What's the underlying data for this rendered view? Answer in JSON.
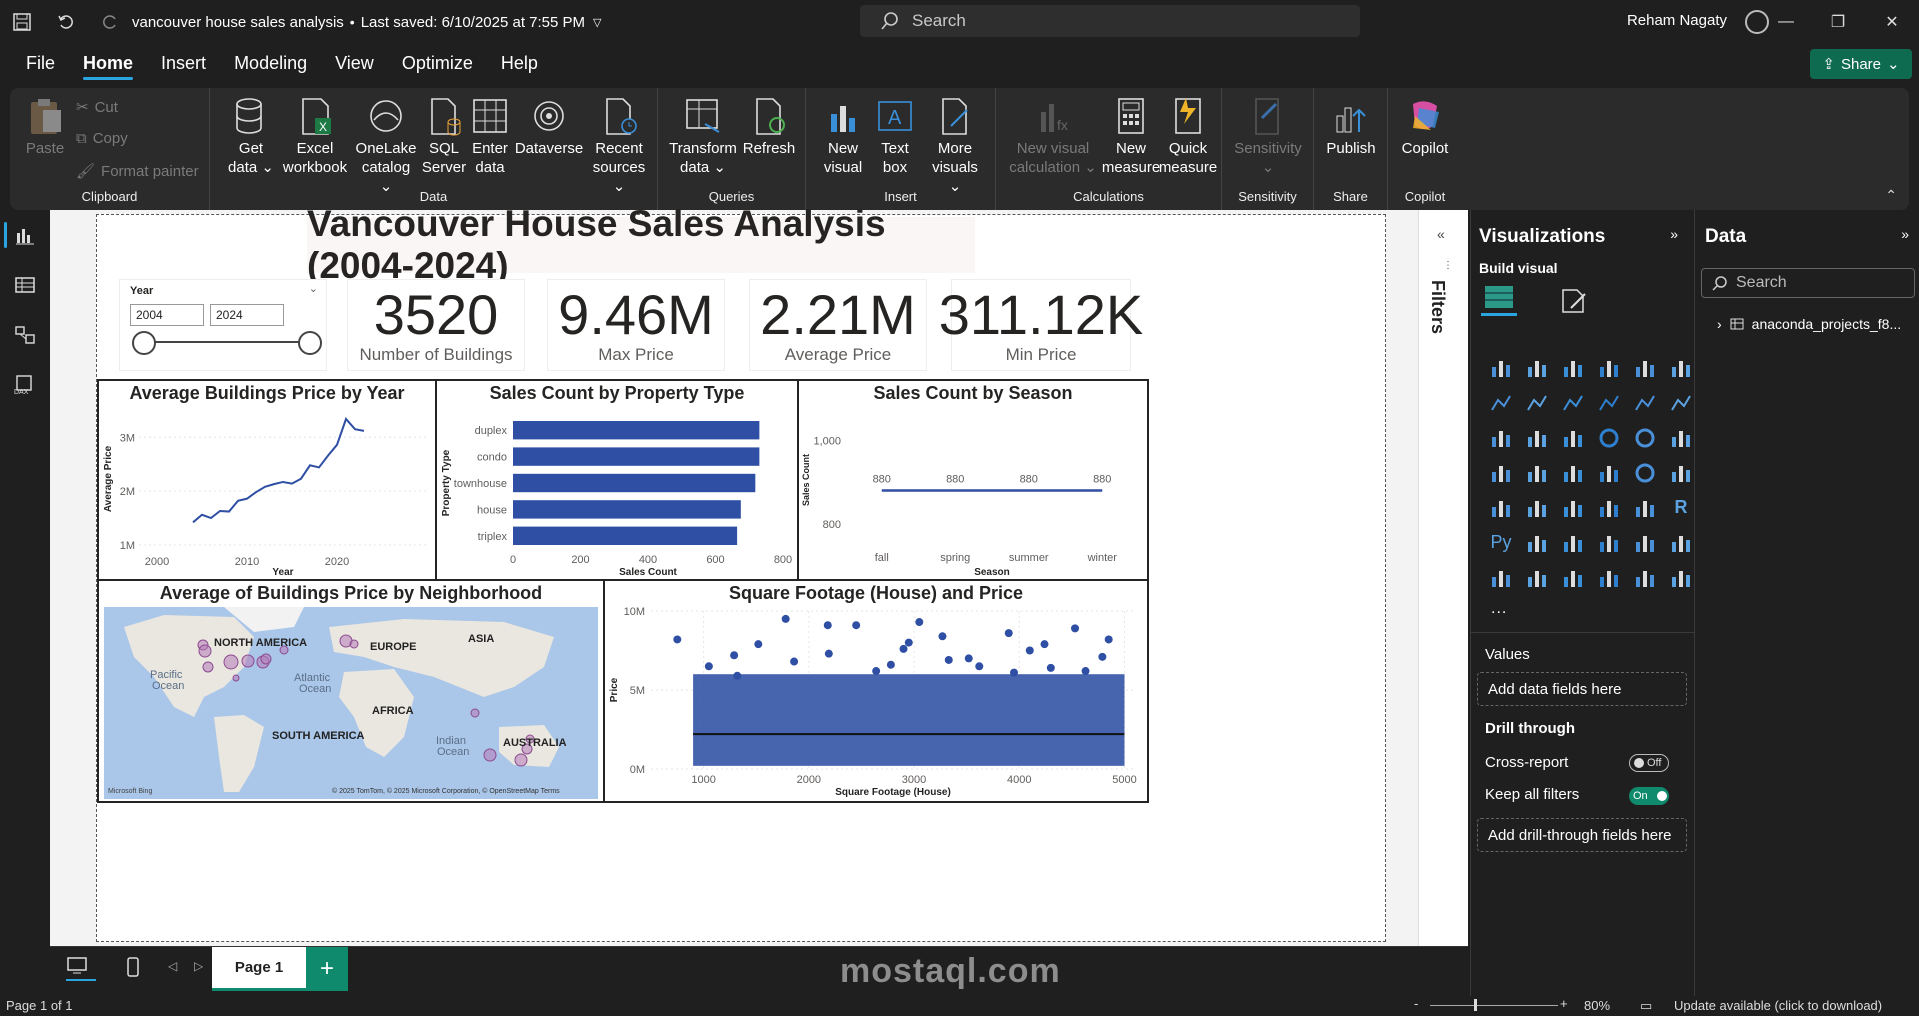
{
  "titlebar": {
    "title": "vancouver house sales analysis",
    "saved": "Last saved: 6/10/2025 at 7:55 PM",
    "search_placeholder": "Search",
    "user": "Reham Nagaty"
  },
  "menu": {
    "items": [
      "File",
      "Home",
      "Insert",
      "Modeling",
      "View",
      "Optimize",
      "Help"
    ],
    "share": "Share"
  },
  "ribbon": {
    "clipboard": {
      "label": "Clipboard",
      "paste": "Paste",
      "cut": "Cut",
      "copy": "Copy",
      "format_painter": "Format painter"
    },
    "data": {
      "label": "Data",
      "get_data": [
        "Get",
        "data ⌄"
      ],
      "excel": [
        "Excel",
        "workbook"
      ],
      "onelake": [
        "OneLake",
        "catalog ⌄"
      ],
      "sql": [
        "SQL",
        "Server"
      ],
      "enter": [
        "Enter",
        "data"
      ],
      "dataverse": [
        "Dataverse"
      ],
      "recent": [
        "Recent",
        "sources ⌄"
      ]
    },
    "queries": {
      "label": "Queries",
      "transform": [
        "Transform",
        "data ⌄"
      ],
      "refresh": [
        "Refresh"
      ]
    },
    "insert": {
      "label": "Insert",
      "new_visual": [
        "New",
        "visual"
      ],
      "text_box": [
        "Text",
        "box"
      ],
      "more_visuals": [
        "More",
        "visuals ⌄"
      ]
    },
    "calculations": {
      "label": "Calculations",
      "new_visual_calc": [
        "New visual",
        "calculation ⌄"
      ],
      "new_measure": [
        "New",
        "measure"
      ],
      "quick_measure": [
        "Quick",
        "measure"
      ]
    },
    "sensitivity": {
      "label": "Sensitivity",
      "btn": [
        "Sensitivity",
        "⌄"
      ]
    },
    "share": {
      "label": "Share",
      "publish": [
        "Publish"
      ]
    },
    "copilot": {
      "label": "Copilot",
      "btn": [
        "Copilot"
      ]
    }
  },
  "report": {
    "title": "Vancouver House Sales Analysis (2004-2024)",
    "slicer": {
      "label": "Year",
      "from": "2004",
      "to": "2024"
    },
    "cards": [
      {
        "value": "3520",
        "label": "Number of Buildings"
      },
      {
        "value": "9.46M",
        "label": "Max Price"
      },
      {
        "value": "2.21M",
        "label": "Average Price"
      },
      {
        "value": "311.12K",
        "label": "Min Price"
      }
    ],
    "map": {
      "title": "Average of Buildings Price by Neighborhood",
      "labels": [
        "NORTH AMERICA",
        "EUROPE",
        "ASIA",
        "Pacific",
        "Ocean",
        "Atlantic",
        "Ocean",
        "AFRICA",
        "SOUTH AMERICA",
        "Indian",
        "Ocean",
        "AUSTRALIA"
      ],
      "attribution": "© 2025 TomTom, © 2025 Microsoft Corporation, © OpenStreetMap  Terms",
      "bing": "Microsoft Bing"
    }
  },
  "chart_data": [
    {
      "type": "line",
      "title": "Average Buildings Price by Year",
      "xlabel": "Year",
      "ylabel": "Average Price",
      "x": [
        2004,
        2005,
        2006,
        2007,
        2008,
        2009,
        2010,
        2011,
        2012,
        2013,
        2014,
        2015,
        2016,
        2017,
        2018,
        2019,
        2020,
        2021,
        2022,
        2023
      ],
      "y": [
        1.42,
        1.56,
        1.5,
        1.63,
        1.62,
        1.82,
        1.86,
        1.98,
        2.08,
        2.13,
        2.17,
        2.14,
        2.23,
        2.48,
        2.44,
        2.66,
        2.86,
        3.34,
        3.15,
        3.12
      ],
      "xticks": [
        "2000",
        "2010",
        "2020"
      ],
      "yticks": [
        "1M",
        "2M",
        "3M"
      ],
      "xlim": [
        1998,
        2030
      ],
      "ylim": [
        0.85,
        3.6
      ]
    },
    {
      "type": "bar",
      "orientation": "horizontal",
      "title": "Sales Count by Property Type",
      "xlabel": "Sales Count",
      "ylabel": "Property Type",
      "categories": [
        "duplex",
        "condo",
        "townhouse",
        "house",
        "triplex"
      ],
      "values": [
        730,
        730,
        718,
        675,
        664
      ],
      "xticks": [
        "0",
        "200",
        "400",
        "600",
        "800"
      ],
      "xlim": [
        0,
        800
      ]
    },
    {
      "type": "line",
      "title": "Sales Count by Season",
      "xlabel": "Season",
      "ylabel": "Sales Count",
      "categories": [
        "fall",
        "spring",
        "summer",
        "winter"
      ],
      "values": [
        880,
        880,
        880,
        880
      ],
      "data_labels": [
        "880",
        "880",
        "880",
        "880"
      ],
      "yticks": [
        "800",
        "1,000"
      ],
      "ylim": [
        740,
        1070
      ]
    },
    {
      "type": "scatter",
      "title": "Square Footage (House) and Price",
      "xlabel": "Square Footage (House)",
      "ylabel": "Price",
      "xticks": [
        "1000",
        "2000",
        "3000",
        "4000",
        "5000"
      ],
      "yticks": [
        "0M",
        "5M",
        "10M"
      ],
      "xlim": [
        500,
        5100
      ],
      "ylim": [
        0,
        10
      ],
      "trend_y": 2.21,
      "points": [
        [
          750,
          8.2
        ],
        [
          1050,
          6.5
        ],
        [
          1520,
          7.9
        ],
        [
          1860,
          6.8
        ],
        [
          1780,
          9.5
        ],
        [
          2190,
          7.3
        ],
        [
          2450,
          9.1
        ],
        [
          2780,
          6.6
        ],
        [
          2950,
          8.0
        ],
        [
          3050,
          9.3
        ],
        [
          3520,
          7.0
        ],
        [
          3620,
          6.5
        ],
        [
          3900,
          8.6
        ],
        [
          4240,
          7.9
        ],
        [
          4530,
          8.9
        ],
        [
          4630,
          6.2
        ],
        [
          4850,
          8.2
        ],
        [
          1320,
          5.9
        ],
        [
          2640,
          6.2
        ],
        [
          3330,
          6.9
        ],
        [
          4100,
          7.5
        ],
        [
          4790,
          7.1
        ],
        [
          1290,
          7.2
        ],
        [
          2180,
          9.1
        ],
        [
          3270,
          8.4
        ],
        [
          3950,
          6.1
        ],
        [
          4300,
          6.4
        ],
        [
          2900,
          7.6
        ]
      ]
    }
  ],
  "filters": {
    "label": "Filters"
  },
  "viz_pane": {
    "title": "Visualizations",
    "build": "Build visual",
    "values": "Values",
    "add_fields": "Add data fields here",
    "drill": "Drill through",
    "cross": "Cross-report",
    "cross_state": "Off",
    "keep": "Keep all filters",
    "keep_state": "On",
    "add_drill": "Add drill-through fields here",
    "more": "...",
    "icons": [
      "stacked-bar-icon",
      "stacked-column-icon",
      "clustered-bar-icon",
      "clustered-column-icon",
      "100-bar-icon",
      "100-column-icon",
      "line-chart-icon",
      "area-chart-icon",
      "stacked-area-icon",
      "ribbon-chart-icon",
      "line-column-icon",
      "line-stacked-column-icon",
      "waterfall-icon",
      "funnel-icon",
      "scatter-icon",
      "pie-icon",
      "donut-icon",
      "treemap-icon",
      "map-icon",
      "filled-map-icon",
      "shape-map-icon",
      "azure-map-icon",
      "gauge-icon",
      "card-icon",
      "multirow-card-icon",
      "kpi-icon",
      "slicer-icon",
      "table-icon",
      "matrix-icon",
      "r-visual-icon",
      "python-visual-icon",
      "key-influencers-icon",
      "decomposition-tree-icon",
      "qna-icon",
      "narrative-icon",
      "goals-icon",
      "paginated-report-icon",
      "power-apps-icon",
      "power-automate-icon",
      "arcgis-icon",
      "diamond-icon",
      "chevron-icon"
    ],
    "r_label": "R",
    "py_label": "Py"
  },
  "data_pane": {
    "title": "Data",
    "search": "Search",
    "table": "anaconda_projects_f8..."
  },
  "tabs": {
    "page1": "Page 1",
    "add": "+"
  },
  "status": {
    "page": "Page 1 of 1",
    "zoom": "80%",
    "update": "Update available (click to download)"
  },
  "watermark": {
    "text": "mostaql.com"
  },
  "colors": {
    "accent": "#2aa5e0",
    "bar": "#2e4fa3",
    "share": "#0f6b4f"
  }
}
